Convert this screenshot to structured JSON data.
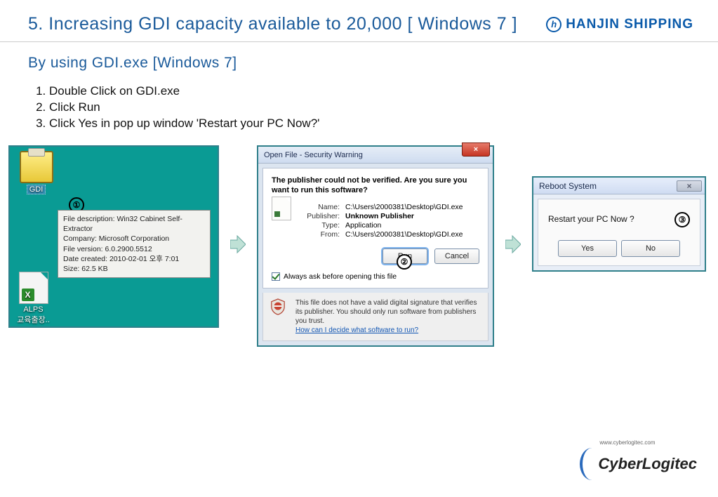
{
  "header": {
    "title": "5. Increasing GDI capacity available to 20,000 [ Windows 7 ]",
    "brand_name": "HANJIN SHIPPING",
    "brand_mark": "h"
  },
  "subheading": "By using GDI.exe [Windows 7]",
  "steps": [
    "Double Click on GDI.exe",
    "Click Run",
    "Click Yes in pop up window 'Restart your PC Now?'"
  ],
  "panel1": {
    "icon1_label": "GDI",
    "icon2_label_line1": "ALPS",
    "icon2_label_line2": "교육출장..",
    "tooltip": {
      "l1": "File description: Win32 Cabinet Self-Extractor",
      "l2": "Company: Microsoft Corporation",
      "l3": "File version: 6.0.2900.5512",
      "l4": "Date created: 2010-02-01 오후 7:01",
      "l5": "Size: 62.5 KB"
    },
    "callout": "①"
  },
  "panel2": {
    "title": "Open File - Security Warning",
    "close_x": "×",
    "warn": "The publisher could not be verified.  Are you sure you want to run this software?",
    "name_label": "Name:",
    "name_value": "C:\\Users\\2000381\\Desktop\\GDI.exe",
    "publisher_label": "Publisher:",
    "publisher_value": "Unknown Publisher",
    "type_label": "Type:",
    "type_value": "Application",
    "from_label": "From:",
    "from_value": "C:\\Users\\2000381\\Desktop\\GDI.exe",
    "run_btn": "Run",
    "cancel_btn": "Cancel",
    "checkbox_label": "Always ask before opening this file",
    "footer_text": "This file does not have a valid digital signature that verifies its publisher.  You should only run software from publishers you trust.",
    "footer_link": "How can I decide what software to run?",
    "callout": "②"
  },
  "panel3": {
    "title": "Reboot System",
    "close_x": "×",
    "message": "Restart your PC Now ?",
    "yes_btn": "Yes",
    "no_btn": "No",
    "callout": "③"
  },
  "footer": {
    "logo_text": "CyberLogitec",
    "logo_tiny": "www.cyberlogitec.com"
  }
}
